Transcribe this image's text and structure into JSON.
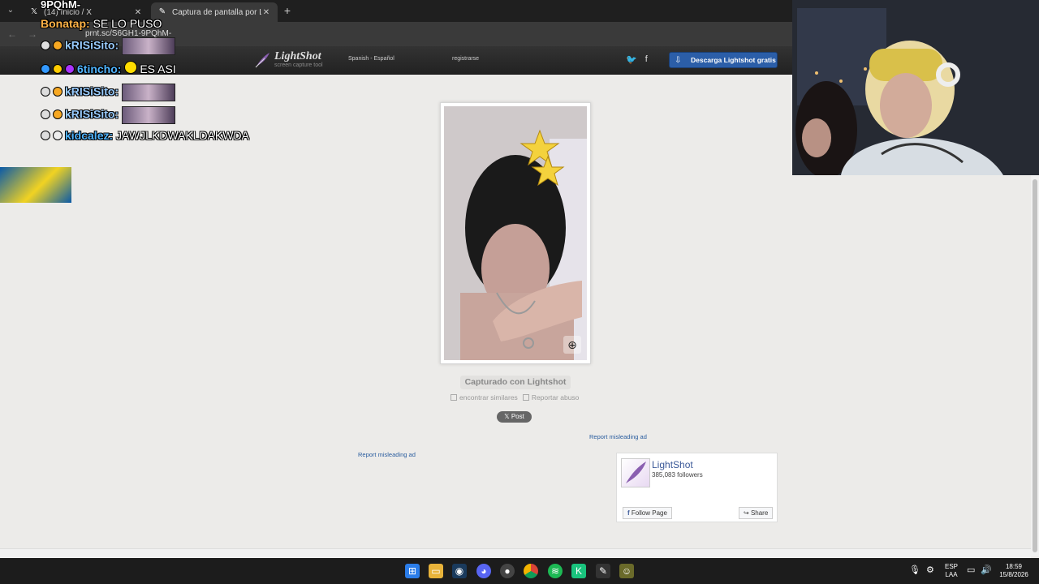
{
  "browser": {
    "tabs": [
      {
        "title": "(14) Inicio / X",
        "icon": "x-logo-icon"
      },
      {
        "title": "Captura de pantalla por LightShot",
        "icon": "lightshot-icon"
      }
    ],
    "url": "prnt.sc/S6GH1-9PQhM-"
  },
  "lightshot": {
    "logo_name": "LightShot",
    "logo_tagline": "screen capture tool",
    "language": "Spanish - Español",
    "register": "registrarse",
    "download_label": "Descarga Lightshot gratis",
    "captured_label": "Capturado con Lightshot",
    "find_similar": "encontrar similares",
    "report_abuse": "Reportar abuso",
    "post_label": "𝕏 Post",
    "report_ad_1": "Report misleading ad",
    "report_ad_2": "Report misleading ad"
  },
  "facebook_widget": {
    "page_name": "LightShot",
    "followers": "385,083 followers",
    "follow_label": "Follow Page",
    "share_label": "Share"
  },
  "chat": {
    "top_fragment": "9PQhM-",
    "lines": [
      {
        "user": "Bonatap",
        "message": "SE LO PUSO"
      },
      {
        "user": "kRISiSito",
        "message": ""
      },
      {
        "user": "6tincho",
        "message": "ES ASI"
      },
      {
        "user": "kRISiSito",
        "message": ""
      },
      {
        "user": "kRISiSito",
        "message": ""
      },
      {
        "user": "kidcalez",
        "message": "JAWJLKDWAKLDAKWDA"
      }
    ]
  },
  "taskbar": {
    "language_top": "ESP",
    "language_bottom": "LAA",
    "time": "18:59",
    "date": "15/8/2026"
  }
}
